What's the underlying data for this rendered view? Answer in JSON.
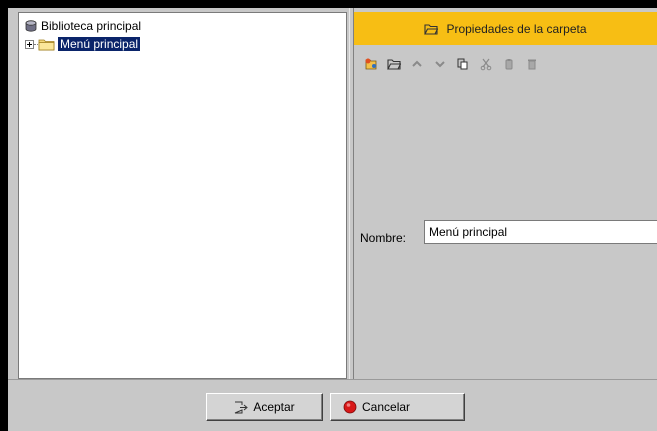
{
  "tree": {
    "root_label": "Biblioteca principal",
    "root_icon": "database-icon",
    "child_label": "Menú principal",
    "child_icon": "folder-icon",
    "selection_color": "#0a246a"
  },
  "properties": {
    "header_title": "Propiedades de la carpeta",
    "header_icon": "folder-open-icon",
    "header_color": "#f7be14",
    "toolbar_icons": [
      "new-item-icon",
      "new-folder-icon",
      "move-up-icon",
      "move-down-icon",
      "copy-icon",
      "cut-icon",
      "paste-icon",
      "delete-icon"
    ],
    "name_label": "Nombre:",
    "name_value": "Menú principal"
  },
  "footer": {
    "accept_label": "Aceptar",
    "accept_icon": "accept-icon",
    "cancel_label": "Cancelar",
    "cancel_icon": "cancel-icon"
  }
}
